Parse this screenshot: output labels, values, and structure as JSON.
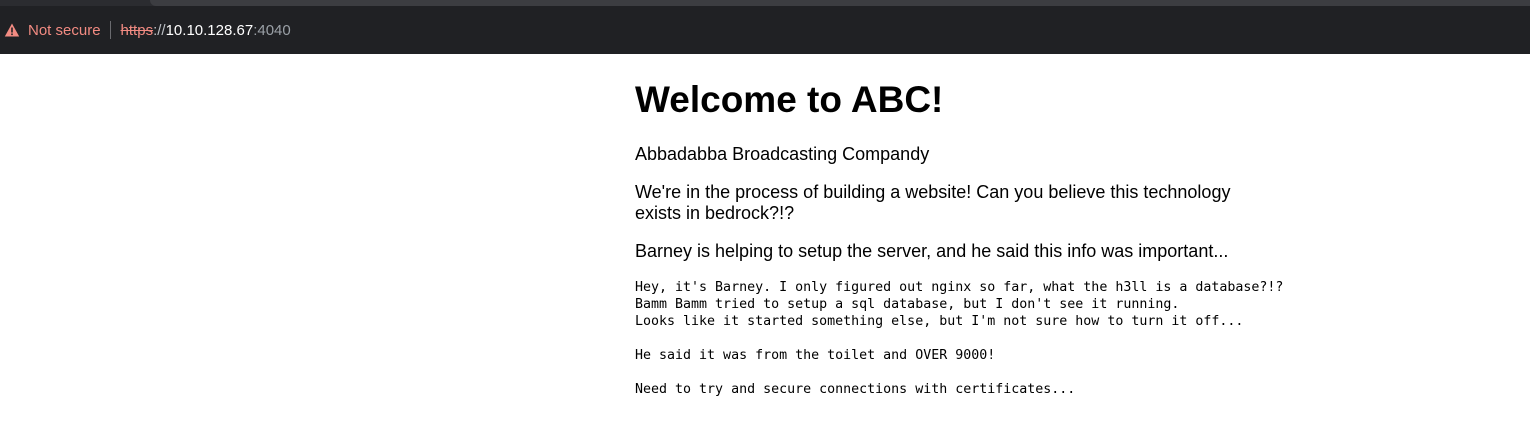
{
  "browser": {
    "security_label": "Not secure",
    "url_scheme": "https",
    "url_slashes": "://",
    "url_host": "10.10.128.67",
    "url_port": ":4040",
    "warning_color": "#f28b82"
  },
  "page": {
    "heading": "Welcome to ABC!",
    "subtitle": "Abbadabba Broadcasting Compandy",
    "paragraph_1": "We're in the process of building a website! Can you believe this technology exists in bedrock?!?",
    "paragraph_2": "Barney is helping to setup the server, and he said this info was important...",
    "note_lines": [
      "Hey, it's Barney. I only figured out nginx so far, what the h3ll is a database?!?",
      "Bamm Bamm tried to setup a sql database, but I don't see it running.",
      "Looks like it started something else, but I'm not sure how to turn it off...",
      "",
      "He said it was from the toilet and OVER 9000!",
      "",
      "Need to try and secure connections with certificates..."
    ]
  }
}
